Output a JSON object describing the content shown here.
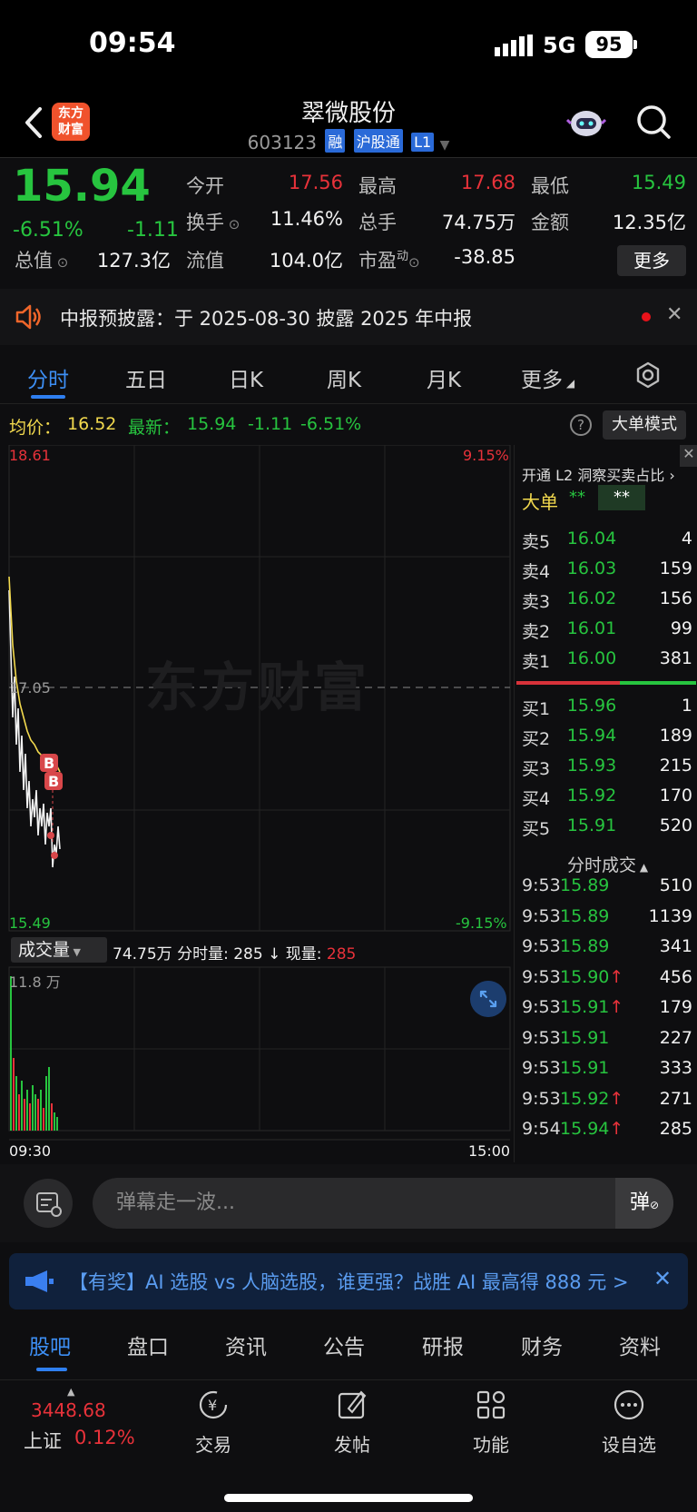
{
  "status_bar": {
    "time": "09:54",
    "network": "5G",
    "battery": "95"
  },
  "header": {
    "logo_text": "东方\n财富",
    "stock_name": "翠微股份",
    "stock_code": "603123",
    "tags": [
      "融",
      "沪股通",
      "L1"
    ]
  },
  "quote": {
    "price": "15.94",
    "change_pct": "-6.51%",
    "change_abs": "-1.11",
    "fields": [
      {
        "label": "今开",
        "value": "17.56",
        "color": "red"
      },
      {
        "label": "最高",
        "value": "17.68",
        "color": "red"
      },
      {
        "label": "最低",
        "value": "15.49",
        "color": "green"
      },
      {
        "label": "换手",
        "value": "11.46%",
        "color": "white"
      },
      {
        "label": "总手",
        "value": "74.75万",
        "color": "white"
      },
      {
        "label": "金额",
        "value": "12.35亿",
        "color": "white"
      },
      {
        "label": "总值",
        "value": "127.3亿",
        "color": "white"
      },
      {
        "label": "流值",
        "value": "104.0亿",
        "color": "white"
      },
      {
        "label": "市盈",
        "label_sup": "动",
        "value": "-38.85",
        "color": "white"
      }
    ],
    "more_label": "更多"
  },
  "notice": {
    "text": "中报预披露：于 2025-08-30 披露 2025 年中报"
  },
  "tabs": {
    "items": [
      "分时",
      "五日",
      "日K",
      "周K",
      "月K",
      "更多"
    ],
    "active": 0
  },
  "avg_row": {
    "avg_label": "均价：",
    "avg_value": "16.52",
    "latest_label": "最新：",
    "latest_value": "15.94",
    "latest_chg": "-1.11",
    "latest_pct": "-6.51%",
    "big_order_label": "大单模式"
  },
  "chart": {
    "y_top": "18.61",
    "y_bottom": "15.49",
    "y_mid": "17.05",
    "pct_top": "9.15%",
    "pct_bottom": "-9.15%",
    "watermark": "东方财富",
    "buy_markers": [
      "B",
      "B"
    ],
    "x_start": "09:30",
    "x_end": "15:00",
    "vol_select_label": "成交量",
    "vol_total": "74.75万",
    "vol_minute_label": "分时量:",
    "vol_minute_value": "285",
    "vol_now_label": "现量:",
    "vol_now_value": "285",
    "vol_max": "11.8 万"
  },
  "book": {
    "promo_text": "开通 L2 洞察买卖占比",
    "big_order_label": "大单",
    "big_order_v1": "**",
    "big_order_v2": "**",
    "asks": [
      {
        "label": "卖5",
        "price": "16.04",
        "vol": "4"
      },
      {
        "label": "卖4",
        "price": "16.03",
        "vol": "159"
      },
      {
        "label": "卖3",
        "price": "16.02",
        "vol": "156"
      },
      {
        "label": "卖2",
        "price": "16.01",
        "vol": "99"
      },
      {
        "label": "卖1",
        "price": "16.00",
        "vol": "381"
      }
    ],
    "bids": [
      {
        "label": "买1",
        "price": "15.96",
        "vol": "1"
      },
      {
        "label": "买2",
        "price": "15.94",
        "vol": "189"
      },
      {
        "label": "买3",
        "price": "15.93",
        "vol": "215"
      },
      {
        "label": "买4",
        "price": "15.92",
        "vol": "170"
      },
      {
        "label": "买5",
        "price": "15.91",
        "vol": "520"
      }
    ],
    "ticks_title": "分时成交",
    "ticks": [
      {
        "time": "9:53",
        "price": "15.89",
        "arrow": "",
        "vol": "510",
        "vol_color": "green"
      },
      {
        "time": "9:53",
        "price": "15.89",
        "arrow": "",
        "vol": "1139",
        "vol_color": "green"
      },
      {
        "time": "9:53",
        "price": "15.89",
        "arrow": "",
        "vol": "341",
        "vol_color": "green"
      },
      {
        "time": "9:53",
        "price": "15.90",
        "arrow": "↑",
        "vol": "456",
        "vol_color": "red"
      },
      {
        "time": "9:53",
        "price": "15.91",
        "arrow": "↑",
        "vol": "179",
        "vol_color": "red"
      },
      {
        "time": "9:53",
        "price": "15.91",
        "arrow": "",
        "vol": "227",
        "vol_color": "green"
      },
      {
        "time": "9:53",
        "price": "15.91",
        "arrow": "",
        "vol": "333",
        "vol_color": "green"
      },
      {
        "time": "9:53",
        "price": "15.92",
        "arrow": "↑",
        "vol": "271",
        "vol_color": "red"
      },
      {
        "time": "9:54",
        "price": "15.94",
        "arrow": "↑",
        "vol": "285",
        "vol_color": "red"
      }
    ]
  },
  "danmu": {
    "placeholder": "弹幕走一波...",
    "toggle_label": "弹"
  },
  "ad": {
    "text": "【有奖】AI 选股 vs 人脑选股，谁更强？战胜 AI 最高得 888 元 >"
  },
  "bottom_tabs": {
    "items": [
      "股吧",
      "盘口",
      "资讯",
      "公告",
      "研报",
      "财务",
      "资料"
    ],
    "active": 0
  },
  "bottom_nav": {
    "index_value": "3448.68",
    "index_name": "上证",
    "index_change": "0.12%",
    "items": [
      "交易",
      "发帖",
      "功能",
      "设自选"
    ]
  },
  "colors": {
    "up": "#e8323a",
    "down": "#27c43f",
    "accent": "#3d8ff5",
    "avg_line": "#f2d94e"
  }
}
